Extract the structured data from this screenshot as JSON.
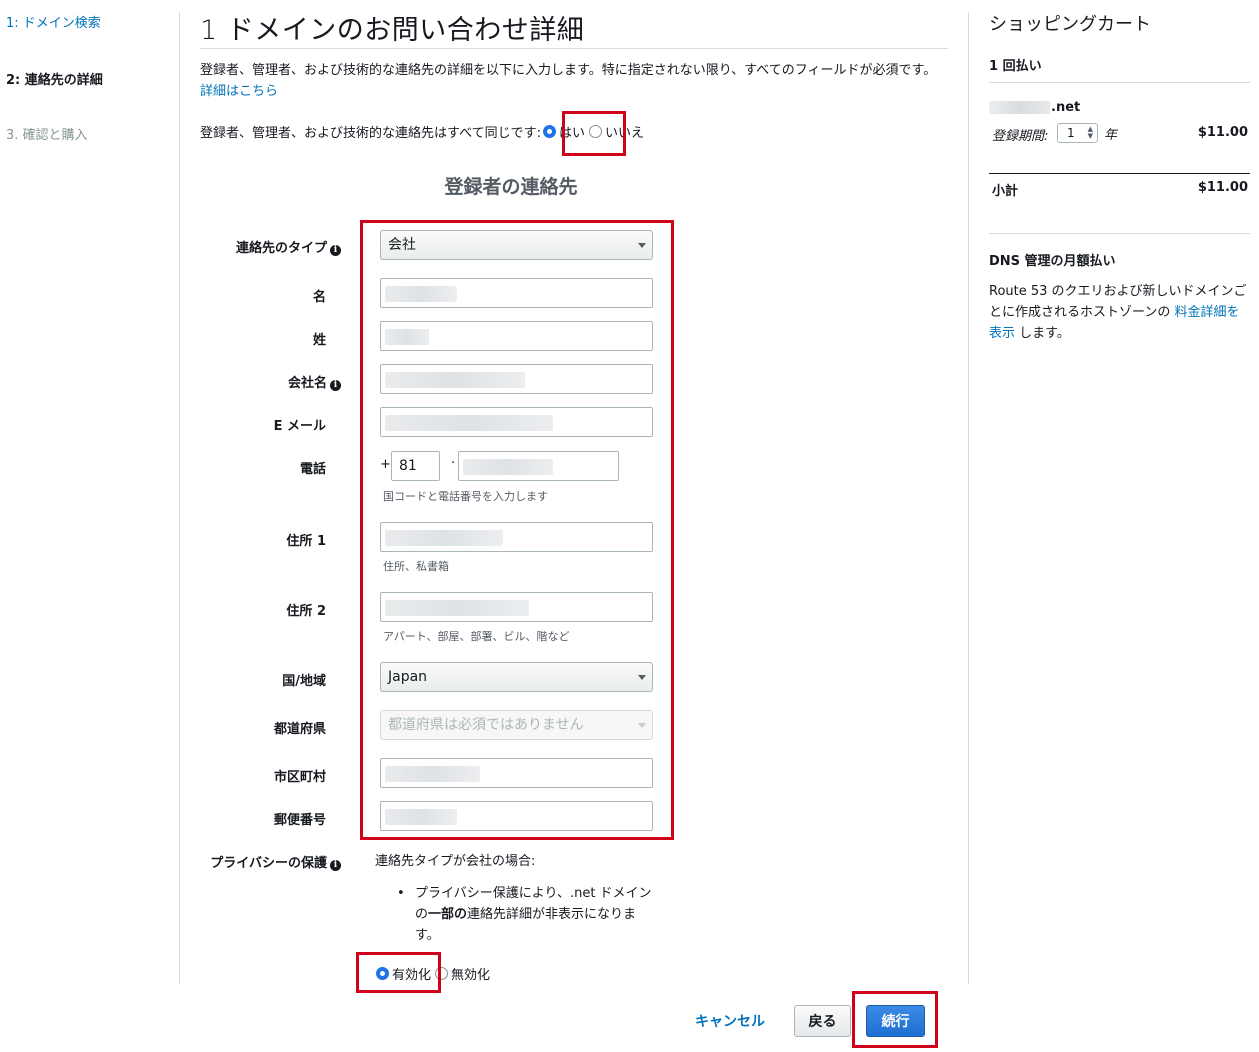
{
  "steps": {
    "step1": "1: ドメイン検索",
    "step2": "2: 連絡先の詳細",
    "step3": "3. 確認と購入"
  },
  "page": {
    "title": "1 ドメインのお問い合わせ詳細",
    "intro_text": "登録者、管理者、および技術的な連絡先の詳細を以下に入力します。特に指定されない限り、すべてのフィールドが必須です。",
    "intro_link": "詳細はこちら",
    "same_contacts_question": "登録者、管理者、および技術的な連絡先はすべて同じです:",
    "yes_label": "はい",
    "no_label": "いいえ",
    "same_contacts_selected": "はい"
  },
  "registrant": {
    "section_title": "登録者の連絡先",
    "contact_type_label": "連絡先のタイプ",
    "contact_type_value": "会社",
    "first_name_label": "名",
    "last_name_label": "姓",
    "company_label": "会社名",
    "email_label": "E メール",
    "phone_label": "電話",
    "phone_plus": "+",
    "phone_country_code": "81",
    "phone_separator": "·",
    "phone_hint": "国コードと電話番号を入力します",
    "address1_label": "住所 1",
    "address1_hint": "住所、私書箱",
    "address2_label": "住所 2",
    "address2_hint": "アパート、部屋、部署、ビル、階など",
    "country_label": "国/地域",
    "country_value": "Japan",
    "state_label": "都道府県",
    "state_placeholder": "都道府県は必須ではありません",
    "city_label": "市区町村",
    "postal_label": "郵便番号"
  },
  "privacy": {
    "label": "プライバシーの保護",
    "condition": "連絡先タイプが会社の場合:",
    "bullet_before": "プライバシー保護により、.net ドメインの",
    "bullet_bold": "一部の",
    "bullet_after": "連絡先詳細が非表示になります。",
    "enable_label": "有効化",
    "disable_label": "無効化",
    "selected": "有効化"
  },
  "buttons": {
    "cancel": "キャンセル",
    "back": "戻る",
    "continue": "続行"
  },
  "cart": {
    "title": "ショッピングカート",
    "payment_type": "1 回払い",
    "domain_suffix": ".net",
    "period_label": "登録期間:",
    "period_value": "1",
    "period_unit": "年",
    "item_price": "$11.00",
    "subtotal_label": "小計",
    "subtotal_price": "$11.00",
    "dns_title": "DNS 管理の月額払い",
    "dns_text": "Route 53 のクエリおよび新しいドメインごとに作成されるホストゾーンの",
    "dns_link": "料金詳細を表示",
    "dns_text_after": "します。"
  },
  "colors": {
    "link": "#0073bb",
    "highlight": "#d0021b",
    "primary_button": "#1e6fd0"
  }
}
